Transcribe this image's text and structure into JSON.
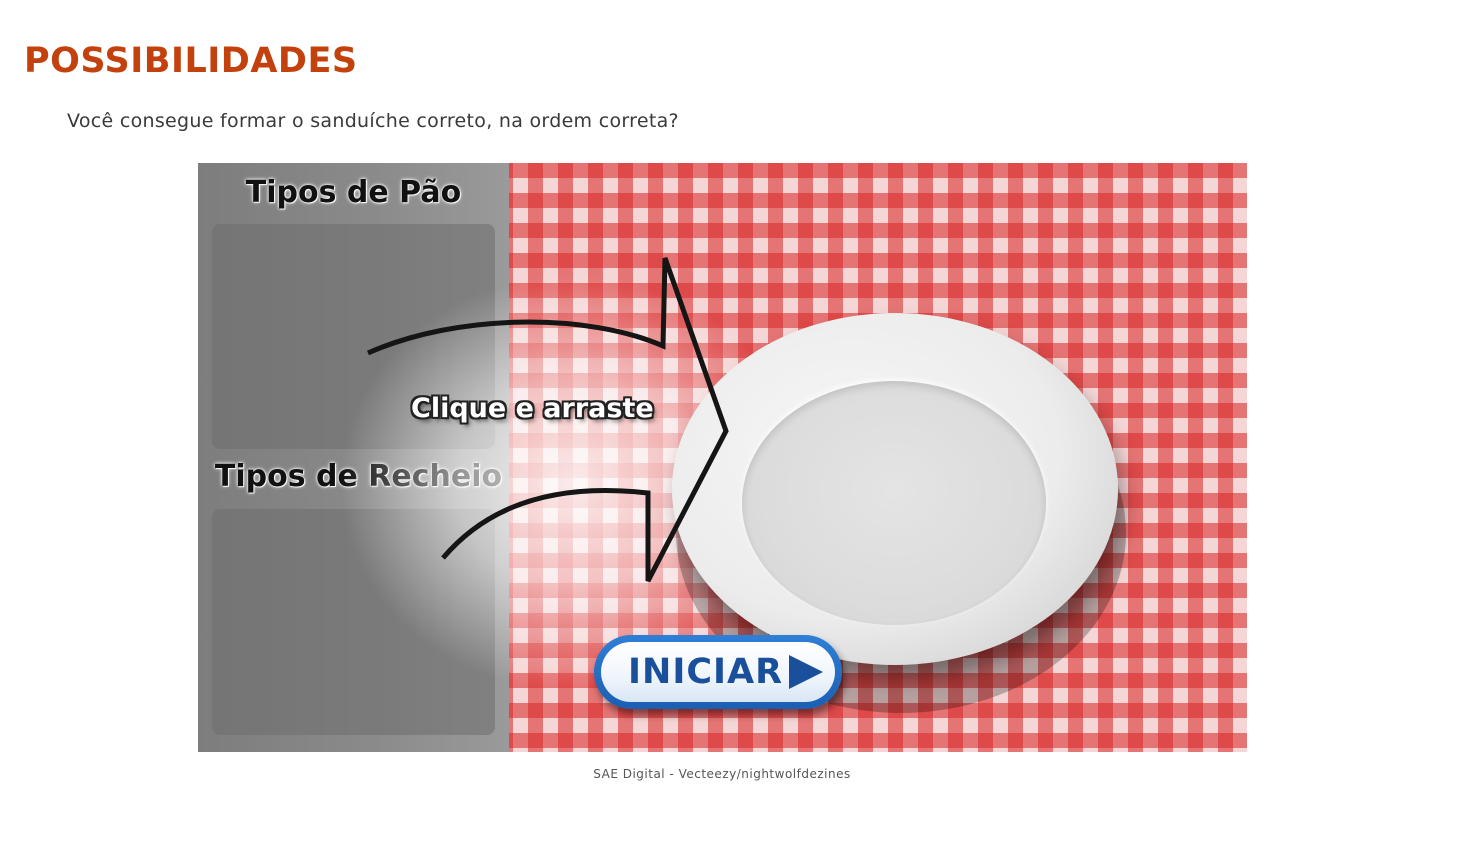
{
  "page": {
    "title": "POSSIBILIDADES",
    "question": "Você consegue formar o sanduíche correto, na ordem correta?",
    "credit": "SAE Digital - Vecteezy/nightwolfdezines"
  },
  "game": {
    "bread_heading": "Tipos de Pão",
    "filling_heading": "Tipos de Recheio",
    "instruction": "Clique e arraste",
    "start_button": "INICIAR",
    "icons": [
      "arrow-icon",
      "play-icon"
    ]
  },
  "colors": {
    "title": "#c2410c",
    "tablecloth_red": "#d32f2f",
    "button_blue": "#1a4f9c"
  }
}
